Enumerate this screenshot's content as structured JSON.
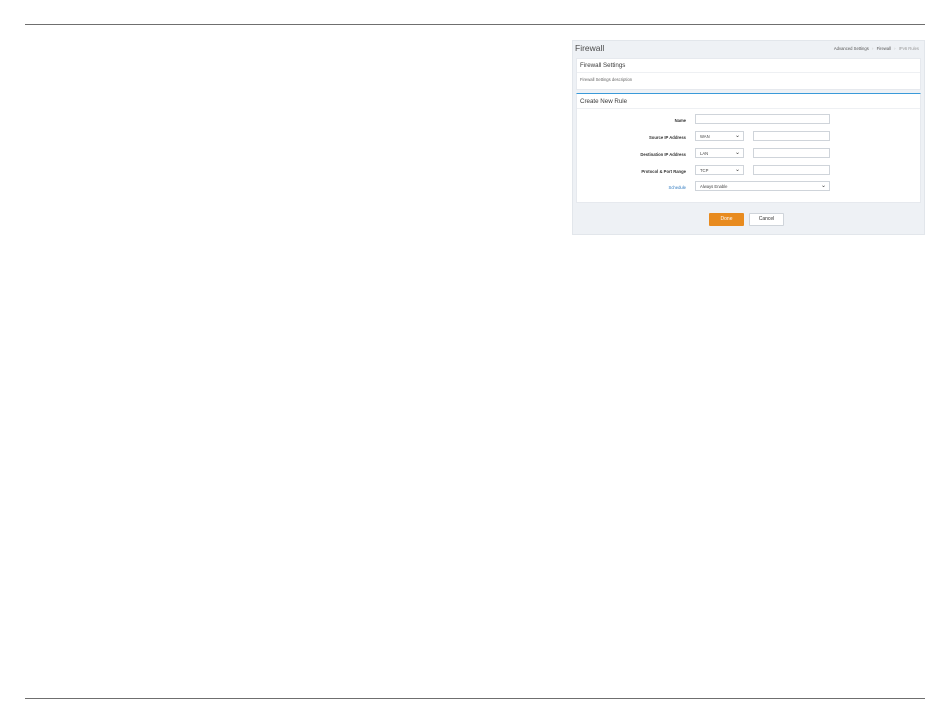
{
  "app": {
    "page_title": "Firewall",
    "breadcrumb": [
      "Advanced Settings",
      "Firewall",
      "IPv6 Rules"
    ]
  },
  "settings_panel": {
    "title": "Firewall Settings",
    "description": "Firewall Settings description"
  },
  "rule_panel": {
    "title": "Create New Rule",
    "fields": {
      "name": {
        "label": "Name",
        "value": ""
      },
      "source_ip": {
        "label": "Source IP Address",
        "select": "WAN",
        "value": ""
      },
      "destination_ip": {
        "label": "Destination IP Address",
        "select": "LAN",
        "value": ""
      },
      "protocol": {
        "label": "Protocol & Port Range",
        "select": "TCP",
        "value": ""
      },
      "schedule": {
        "label": "Schedule",
        "select": "Always Enable"
      }
    }
  },
  "actions": {
    "done_label": "Done",
    "cancel_label": "Cancel"
  },
  "colors": {
    "accent": "#3a9ad9",
    "primary_button": "#e88b1f",
    "link": "#2f7ac0"
  }
}
